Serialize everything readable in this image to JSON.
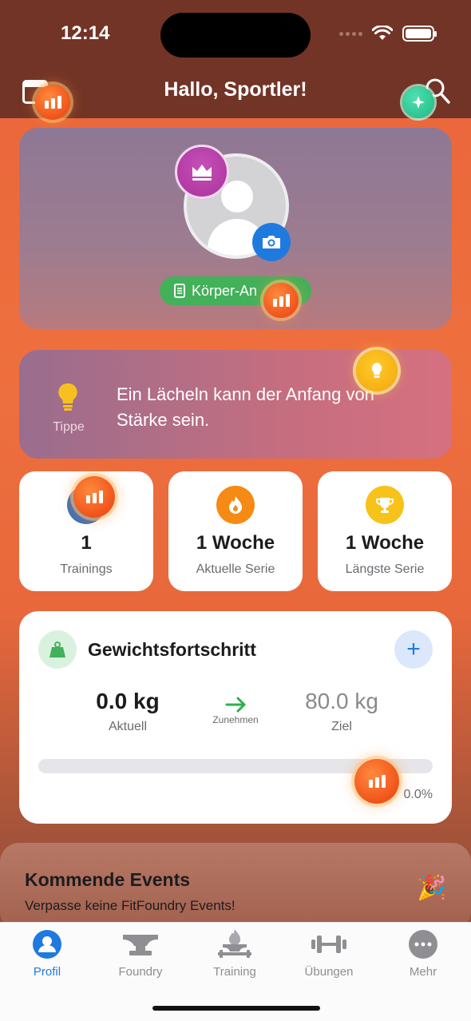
{
  "status_bar": {
    "time": "12:14"
  },
  "header": {
    "greeting": "Hallo, Sportler!"
  },
  "profile": {
    "body_button_label": "Körper-An"
  },
  "tip": {
    "label": "Tippe",
    "text": "Ein Lächeln kann der Anfang von Stärke sein."
  },
  "stats": [
    {
      "value": "1",
      "label": "Trainings",
      "icon": "chart-bars-icon"
    },
    {
      "value": "1 Woche",
      "label": "Aktuelle Serie",
      "icon": "flame-icon"
    },
    {
      "value": "1 Woche",
      "label": "Längste Serie",
      "icon": "trophy-icon"
    }
  ],
  "weight": {
    "title": "Gewichtsfortschritt",
    "current_value": "0.0 kg",
    "current_label": "Aktuell",
    "direction_label": "Zunehmen",
    "goal_value": "80.0 kg",
    "goal_label": "Ziel",
    "progress_text": "0.0%",
    "progress_fraction": 0.0
  },
  "events": {
    "title": "Kommende Events",
    "subtitle": "Verpasse keine FitFoundry Events!",
    "emoji": "🎉"
  },
  "tabs": [
    {
      "label": "Profil",
      "icon": "person-icon",
      "active": true
    },
    {
      "label": "Foundry",
      "icon": "anvil-icon",
      "active": false
    },
    {
      "label": "Training",
      "icon": "forge-icon",
      "active": false
    },
    {
      "label": "Übungen",
      "icon": "dumbbell-icon",
      "active": false
    },
    {
      "label": "Mehr",
      "icon": "more-icon",
      "active": false
    }
  ],
  "colors": {
    "accent_blue": "#1f7ae0",
    "accent_green": "#43b05a",
    "header_bg": "#723426",
    "badge_orange": "#f0531a"
  }
}
